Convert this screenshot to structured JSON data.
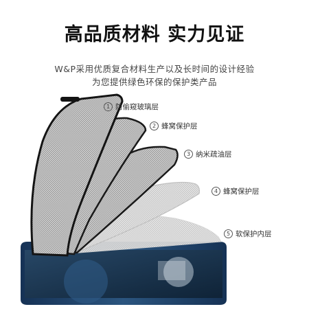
{
  "headline": "高品质材料 实力见证",
  "subtitle": {
    "line1": "W&P采用优质复合材料生产以及长时间的设计经验",
    "line2": "为您提供绿色环保的保护类产品"
  },
  "layers": [
    {
      "num": "1",
      "label": "防偷窥玻璃层"
    },
    {
      "num": "2",
      "label": "蜂窝保护层"
    },
    {
      "num": "3",
      "label": "纳米疏油层"
    },
    {
      "num": "4",
      "label": "蜂窝保护层"
    },
    {
      "num": "5",
      "label": "软保护内层"
    }
  ],
  "colors": {
    "phone_frame": "#1f3f66",
    "film_dark": "#1a1a1a",
    "screen": "#1d3a57"
  }
}
